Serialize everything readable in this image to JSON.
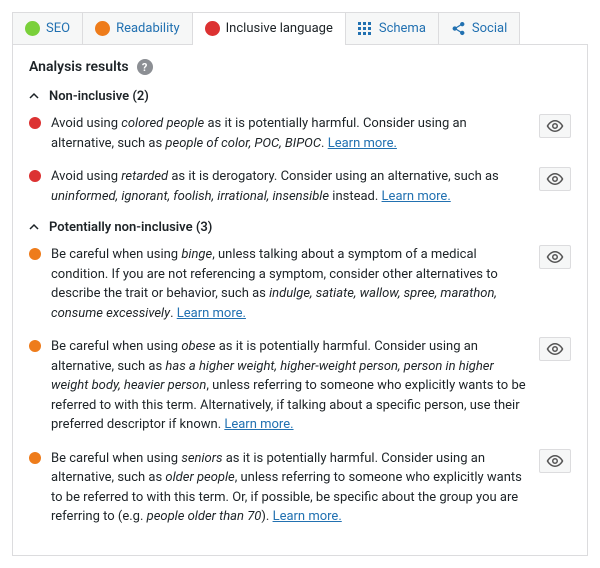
{
  "tabs": {
    "seo": "SEO",
    "readability": "Readability",
    "inclusive": "Inclusive language",
    "schema": "Schema",
    "social": "Social"
  },
  "results_title": "Analysis results",
  "groups": {
    "non_inclusive": {
      "label": "Non-inclusive (2)"
    },
    "potentially": {
      "label": "Potentially non-inclusive (3)"
    }
  },
  "learn_more": "Learn more.",
  "items": {
    "colored_people": {
      "prefix": "Avoid using ",
      "term": "colored people",
      "mid": " as it is potentially harmful. Consider using an alternative, such as ",
      "alt": "people of color, POC, BIPOC",
      "suffix": ". "
    },
    "retarded": {
      "prefix": "Avoid using ",
      "term": "retarded",
      "mid": " as it is derogatory. Consider using an alternative, such as ",
      "alt": "uninformed, ignorant, foolish, irrational, insensible",
      "suffix": " instead. "
    },
    "binge": {
      "prefix": "Be careful when using ",
      "term": "binge",
      "mid": ", unless talking about a symptom of a medical condition. If you are not referencing a symptom, consider other alternatives to describe the trait or behavior, such as ",
      "alt": "indulge, satiate, wallow, spree, marathon, consume excessively",
      "suffix": ". "
    },
    "obese": {
      "prefix": "Be careful when using ",
      "term": "obese",
      "mid": " as it is potentially harmful. Consider using an alternative, such as ",
      "alt": "has a higher weight, higher-weight person, person in higher weight body, heavier person",
      "suffix": ", unless referring to someone who explicitly wants to be referred to with this term. Alternatively, if talking about a specific person, use their preferred descriptor if known. "
    },
    "seniors": {
      "prefix": "Be careful when using ",
      "term": "seniors",
      "mid": " as it is potentially harmful. Consider using an alternative, such as ",
      "alt": "older people",
      "suffix1": ", unless referring to someone who explicitly wants to be referred to with this term. Or, if possible, be specific about the group you are referring to (e.g. ",
      "example": "people older than 70",
      "suffix2": "). "
    }
  }
}
